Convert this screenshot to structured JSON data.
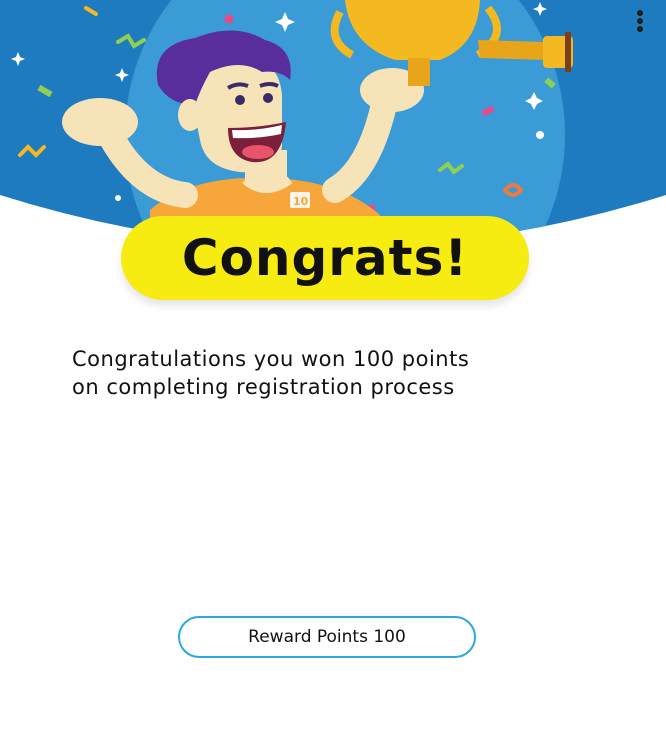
{
  "hero": {
    "player_number": "10",
    "icons": [
      "trophy-icon",
      "kebab-menu-icon"
    ]
  },
  "banner": {
    "title": "Congrats!"
  },
  "message": {
    "line1": "Congratulations you won 100 points",
    "line2": "on completing registration process"
  },
  "reward_button": {
    "label": "Reward Points 100"
  },
  "colors": {
    "hero_blue": "#1f7bbf",
    "circle_blue": "#3a9bd6",
    "banner_yellow": "#f6ec12",
    "trophy_gold": "#f4b820",
    "button_border": "#2aa8df"
  }
}
